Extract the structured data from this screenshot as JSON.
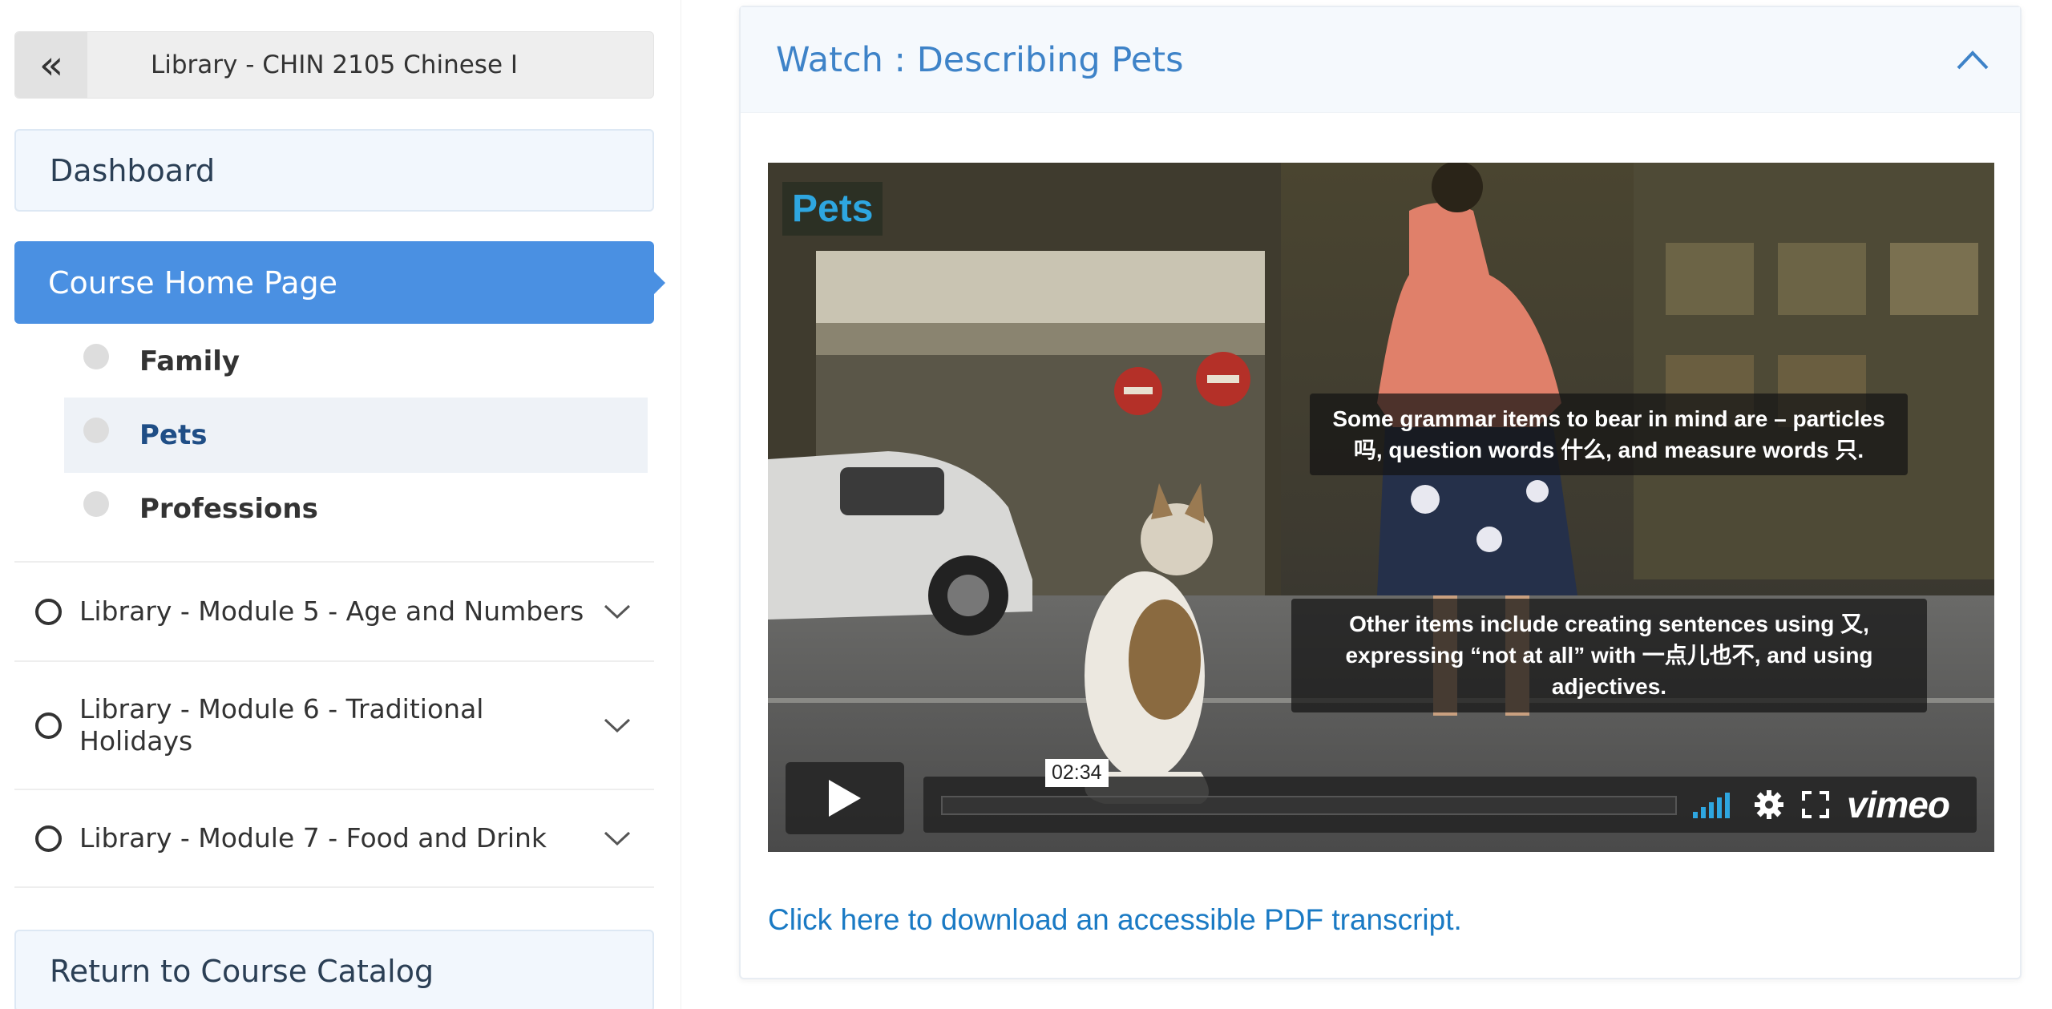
{
  "sidebar": {
    "back_icon": "double-chevron-left-icon",
    "course_title": "Library - CHIN 2105 Chinese I",
    "dashboard": "Dashboard",
    "course_home": "Course Home Page",
    "sub_items": [
      {
        "label": "Family",
        "selected": false
      },
      {
        "label": "Pets",
        "selected": true
      },
      {
        "label": "Professions",
        "selected": false
      }
    ],
    "modules": [
      {
        "label": "Library - Module 5 - Age and Numbers"
      },
      {
        "label": "Library - Module 6 - Traditional Holidays"
      },
      {
        "label": "Library - Module 7 - Food and Drink"
      }
    ],
    "return": "Return to Course Catalog"
  },
  "main": {
    "panel_title": "Watch : Describing Pets",
    "video": {
      "tag": "Pets",
      "caption_1": "Some grammar items to bear in mind are – particles 吗, question words 什么, and measure words 只.",
      "caption_2": "Other items include creating sentences using 又, expressing “not at all” with 一点儿也不, and using adjectives.",
      "time": "02:34",
      "brand": "vimeo",
      "progress": 0
    },
    "transcript_link": "Click here to download an accessible PDF transcript."
  },
  "colors": {
    "accent": "#4a90e2",
    "title_blue": "#3e83c8",
    "link_blue": "#1a7ac4",
    "nav_bg": "#f2f7fd"
  }
}
